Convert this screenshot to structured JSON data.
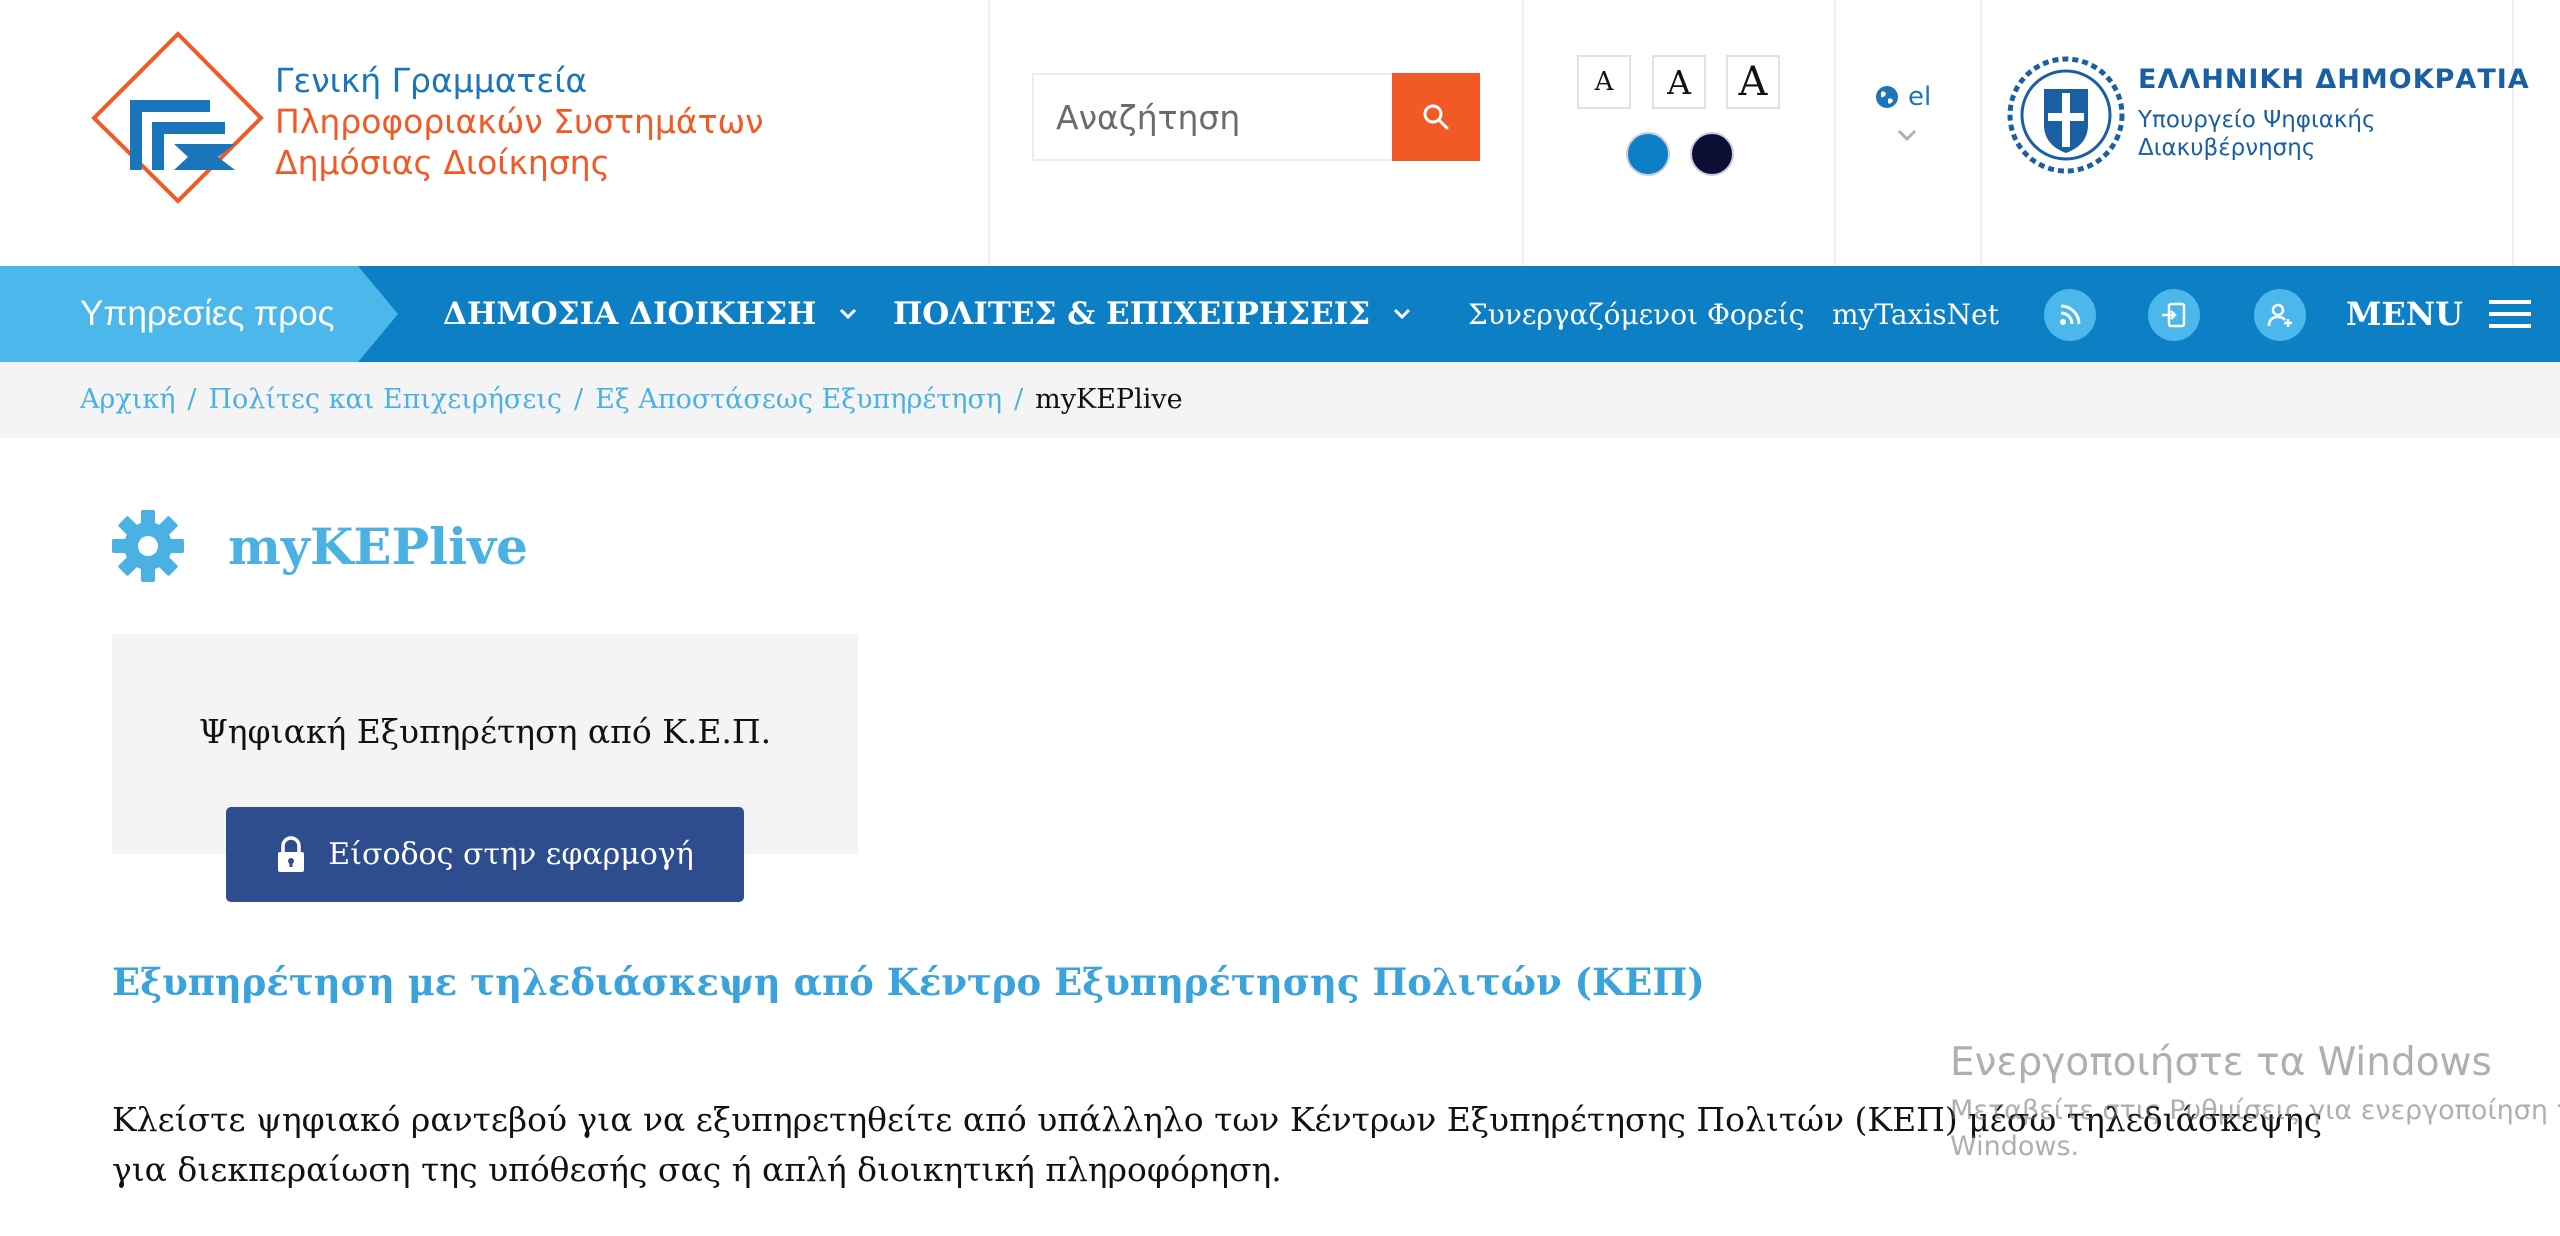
{
  "header": {
    "logo_lines": [
      "Γενική Γραμματεία",
      "Πληροφοριακών Συστημάτων",
      "Δημόσιας Διοίκησης"
    ],
    "search_placeholder": "Αναζήτηση",
    "font_sizes": [
      "A",
      "A",
      "A"
    ],
    "contrast_colors": [
      "#0d7fc4",
      "#0b0f33"
    ],
    "language": "el",
    "gov_title": "ΕΛΛΗΝΙΚΗ ΔΗΜΟΚΡΑΤΙΑ",
    "gov_subtitle_lines": [
      "Υπουργείο Ψηφιακής",
      "Διακυβέρνησης"
    ]
  },
  "nav": {
    "services_label": "Υπηρεσίες προς",
    "public_admin": "ΔΗΜΟΣΙΑ ΔΙΟΙΚΗΣΗ",
    "citizens_business": "ΠΟΛΙΤΕΣ & ΕΠΙΧΕΙΡΗΣΕΙΣ",
    "partners": "Συνεργαζόμενοι Φορείς",
    "mytaxisnet": "myTaxisNet",
    "icons": [
      "rss-icon",
      "login-icon",
      "user-add-icon"
    ],
    "menu_label": "MENU"
  },
  "breadcrumb": {
    "items": [
      "Αρχική",
      "Πολίτες και Επιχειρήσεις",
      "Εξ Αποστάσεως Εξυπηρέτηση"
    ],
    "current": "myKEPlive"
  },
  "main": {
    "title": "myKEPlive",
    "card_text": "Ψηφιακή Εξυπηρέτηση από Κ.Ε.Π.",
    "login_button": "Είσοδος στην εφαρμογή",
    "section_heading": "Εξυπηρέτηση με τηλεδιάσκεψη από Κέντρο Εξυπηρέτησης Πολιτών (ΚΕΠ)",
    "body_text": "Κλείστε ψηφιακό ραντεβού για να εξυπηρετηθείτε από υπάλληλο των Κέντρων Εξυπηρέτησης Πολιτών (ΚΕΠ) μέσω τηλεδιάσκεψης για διεκπεραίωση της υπόθεσής σας ή απλή διοικητική πληροφόρηση."
  },
  "watermark": {
    "line1": "Ενεργοποιήστε τα Windows",
    "line2": "Μεταβείτε στις Ρυθμίσεις για ενεργοποίηση των",
    "line3": "Windows."
  },
  "colors": {
    "brand_blue": "#0d7fc4",
    "light_blue": "#4bb7ea",
    "orange": "#f15a24",
    "button_navy": "#2e4d8f"
  }
}
